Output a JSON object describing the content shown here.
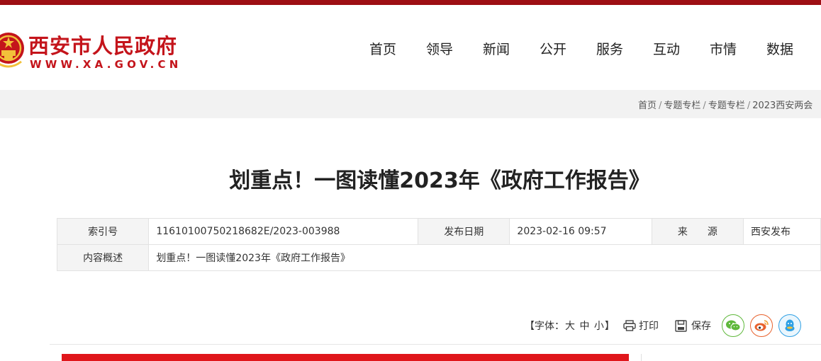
{
  "header": {
    "logo_title": "西安市人民政府",
    "logo_url": "WWW.XA.GOV.CN",
    "nav": [
      "首页",
      "领导",
      "新闻",
      "公开",
      "服务",
      "互动",
      "市情",
      "数据"
    ]
  },
  "breadcrumb": {
    "items": [
      "首页",
      "专题专栏",
      "专题专栏",
      "2023西安两会"
    ]
  },
  "article": {
    "title": "划重点！一图读懂2023年《政府工作报告》"
  },
  "meta": {
    "index_label": "索引号",
    "index_value": "11610100750218682E/2023-003988",
    "date_label": "发布日期",
    "date_value": "2023-02-16 09:57",
    "source_label": "来　　源",
    "source_value": "西安发布",
    "summary_label": "内容概述",
    "summary_value": "划重点！一图读懂2023年《政府工作报告》"
  },
  "tools": {
    "font_open": "【字体：",
    "font_large": "大",
    "font_medium": "中",
    "font_small": "小",
    "font_close": "】",
    "print_label": "打印",
    "save_label": "保存"
  },
  "colors": {
    "brand_red": "#c4141b",
    "top_strip": "#9e0f14",
    "wechat": "#5fb83b",
    "weibo": "#e8612c",
    "qq": "#2fa0e4"
  }
}
